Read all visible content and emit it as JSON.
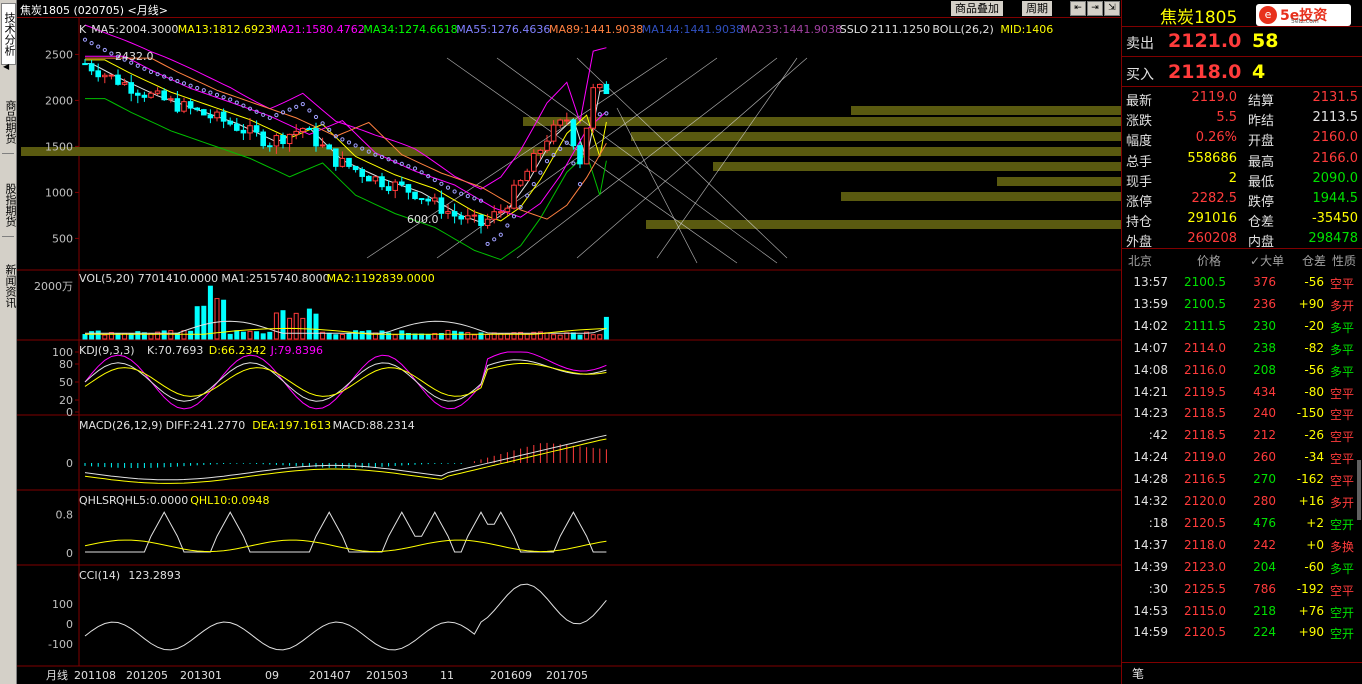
{
  "sidebar": {
    "tabs": [
      "技术分析",
      "商品期货",
      "股指期货",
      "新闻资讯"
    ]
  },
  "topbar": {
    "title": "焦炭1805 (020705)  <月线>",
    "link_overlay": "商品叠加",
    "link_period": "周期"
  },
  "price_panel": {
    "legend": [
      {
        "text": "K",
        "color": "#e0e0e0"
      },
      {
        "text": "MA5:2004.3000",
        "color": "#e0e0e0"
      },
      {
        "text": "MA13:1812.6923",
        "color": "#ffff00"
      },
      {
        "text": "MA21:1580.4762",
        "color": "#ff00ff"
      },
      {
        "text": "MA34:1274.6618",
        "color": "#00ff00"
      },
      {
        "text": "MA55:1276.4636",
        "color": "#8080ff"
      },
      {
        "text": "MA89:1441.9038",
        "color": "#ff8040"
      },
      {
        "text": "MA144:1441.9038",
        "color": "#3050c0"
      },
      {
        "text": "MA233:1441.9038",
        "color": "#a040a0"
      },
      {
        "text": "SSLO",
        "color": "#e0e0e0"
      },
      {
        "text": "2111.1250",
        "color": "#e0e0e0"
      },
      {
        "text": "BOLL(26,2)",
        "color": "#e0e0e0"
      },
      {
        "text": "MID:1406",
        "color": "#ffff00"
      }
    ],
    "yticks": [
      "2500",
      "2000",
      "1500",
      "1000",
      "500"
    ],
    "high_label": "2432.0",
    "low_label": "600.0"
  },
  "vol_panel": {
    "legend": [
      {
        "text": "VOL(5,20) 7701410.0000",
        "color": "#e0e0e0"
      },
      {
        "text": "MA1:2515740.8000",
        "color": "#e0e0e0"
      },
      {
        "text": "MA2:1192839.0000",
        "color": "#ffff00"
      }
    ],
    "ytick": "2000万"
  },
  "kdj_panel": {
    "legend": [
      {
        "text": "KDJ(9,3,3)",
        "color": "#e0e0e0"
      },
      {
        "text": "K:70.7693",
        "color": "#e0e0e0"
      },
      {
        "text": "D:66.2342",
        "color": "#ffff00"
      },
      {
        "text": "J:79.8396",
        "color": "#ff00ff"
      }
    ],
    "yticks": [
      "100",
      "80",
      "50",
      "20",
      "0"
    ]
  },
  "macd_panel": {
    "legend": [
      {
        "text": "MACD(26,12,9)",
        "color": "#e0e0e0"
      },
      {
        "text": "DIFF:241.2770",
        "color": "#e0e0e0"
      },
      {
        "text": "DEA:197.1613",
        "color": "#ffff00"
      },
      {
        "text": "MACD:88.2314",
        "color": "#e0e0e0"
      }
    ],
    "yticks": [
      "0"
    ]
  },
  "qhlsr_panel": {
    "legend": [
      {
        "text": "QHLSR",
        "color": "#e0e0e0"
      },
      {
        "text": "QHL5:0.0000",
        "color": "#e0e0e0"
      },
      {
        "text": "QHL10:0.0948",
        "color": "#ffff00"
      }
    ],
    "yticks": [
      "0.8",
      "0"
    ]
  },
  "cci_panel": {
    "legend": [
      {
        "text": "CCI(14)",
        "color": "#e0e0e0"
      },
      {
        "text": "123.2893",
        "color": "#e0e0e0"
      }
    ],
    "yticks": [
      "100",
      "0",
      "-100"
    ]
  },
  "xaxis": {
    "period_label": "月线",
    "labels": [
      "201108",
      "201205",
      "201301",
      "09",
      "201407",
      "201503",
      "11",
      "201609",
      "201705"
    ]
  },
  "quote": {
    "name": "焦炭1805",
    "brand": "5e投资",
    "brand_url": "5etz.com",
    "sell_label": "卖出",
    "sell_price": "2121.0",
    "sell_vol": "58",
    "buy_label": "买入",
    "buy_price": "2118.0",
    "buy_vol": "4",
    "rows": [
      {
        "l1": "最新",
        "v1": "2119.0",
        "c1": "red",
        "l2": "结算",
        "v2": "2131.5",
        "c2": "red"
      },
      {
        "l1": "涨跌",
        "v1": "5.5",
        "c1": "red",
        "l2": "昨结",
        "v2": "2113.5",
        "c2": "wht"
      },
      {
        "l1": "幅度",
        "v1": "0.26%",
        "c1": "red",
        "l2": "开盘",
        "v2": "2160.0",
        "c2": "red"
      },
      {
        "l1": "总手",
        "v1": "558686",
        "c1": "yel",
        "l2": "最高",
        "v2": "2166.0",
        "c2": "red"
      },
      {
        "l1": "现手",
        "v1": "2",
        "c1": "yel",
        "l2": "最低",
        "v2": "2090.0",
        "c2": "grn"
      },
      {
        "l1": "涨停",
        "v1": "2282.5",
        "c1": "red",
        "l2": "跌停",
        "v2": "1944.5",
        "c2": "grn"
      },
      {
        "l1": "持仓",
        "v1": "291016",
        "c1": "yel",
        "l2": "仓差",
        "v2": "-35450",
        "c2": "yel"
      },
      {
        "l1": "外盘",
        "v1": "260208",
        "c1": "red",
        "l2": "内盘",
        "v2": "298478",
        "c2": "grn"
      }
    ]
  },
  "ticks": {
    "headers": [
      "北京",
      "价格",
      "大单",
      "仓差",
      "性质"
    ],
    "rows": [
      {
        "t": "13:57",
        "p": "2100.5",
        "pc": "grn",
        "v": "376",
        "vc": "red",
        "d": "-56",
        "n": "空平",
        "nc": "red"
      },
      {
        "t": "13:59",
        "p": "2100.5",
        "pc": "grn",
        "v": "236",
        "vc": "red",
        "d": "+90",
        "n": "多开",
        "nc": "red"
      },
      {
        "t": "14:02",
        "p": "2111.5",
        "pc": "grn",
        "v": "230",
        "vc": "grn",
        "d": "-20",
        "n": "多平",
        "nc": "grn"
      },
      {
        "t": "14:07",
        "p": "2114.0",
        "pc": "red",
        "v": "238",
        "vc": "grn",
        "d": "-82",
        "n": "多平",
        "nc": "grn"
      },
      {
        "t": "14:08",
        "p": "2116.0",
        "pc": "red",
        "v": "208",
        "vc": "grn",
        "d": "-56",
        "n": "多平",
        "nc": "grn"
      },
      {
        "t": "14:21",
        "p": "2119.5",
        "pc": "red",
        "v": "434",
        "vc": "red",
        "d": "-80",
        "n": "空平",
        "nc": "red"
      },
      {
        "t": "14:23",
        "p": "2118.5",
        "pc": "red",
        "v": "240",
        "vc": "red",
        "d": "-150",
        "n": "空平",
        "nc": "red"
      },
      {
        "t": ":42",
        "p": "2118.5",
        "pc": "red",
        "v": "212",
        "vc": "red",
        "d": "-26",
        "n": "空平",
        "nc": "red"
      },
      {
        "t": "14:24",
        "p": "2119.0",
        "pc": "red",
        "v": "260",
        "vc": "red",
        "d": "-34",
        "n": "空平",
        "nc": "red"
      },
      {
        "t": "14:28",
        "p": "2116.5",
        "pc": "red",
        "v": "270",
        "vc": "grn",
        "d": "-162",
        "n": "空平",
        "nc": "red"
      },
      {
        "t": "14:32",
        "p": "2120.0",
        "pc": "red",
        "v": "280",
        "vc": "red",
        "d": "+16",
        "n": "多开",
        "nc": "red"
      },
      {
        "t": ":18",
        "p": "2120.5",
        "pc": "red",
        "v": "476",
        "vc": "grn",
        "d": "+2",
        "n": "空开",
        "nc": "grn"
      },
      {
        "t": "14:37",
        "p": "2118.0",
        "pc": "red",
        "v": "242",
        "vc": "red",
        "d": "+0",
        "n": "多换",
        "nc": "red"
      },
      {
        "t": "14:39",
        "p": "2123.0",
        "pc": "red",
        "v": "204",
        "vc": "grn",
        "d": "-60",
        "n": "多平",
        "nc": "grn"
      },
      {
        "t": ":30",
        "p": "2125.5",
        "pc": "red",
        "v": "786",
        "vc": "red",
        "d": "-192",
        "n": "空平",
        "nc": "red"
      },
      {
        "t": "14:53",
        "p": "2115.0",
        "pc": "red",
        "v": "218",
        "vc": "grn",
        "d": "+76",
        "n": "空开",
        "nc": "grn"
      },
      {
        "t": "14:59",
        "p": "2120.5",
        "pc": "red",
        "v": "224",
        "vc": "grn",
        "d": "+90",
        "n": "空开",
        "nc": "grn"
      }
    ],
    "footer_tab": "笔"
  },
  "colors": {
    "up": "#ff3b3b",
    "down": "#00ffff",
    "grid": "#800000",
    "bg": "#000000",
    "volume_profile": "#5a5a10"
  }
}
